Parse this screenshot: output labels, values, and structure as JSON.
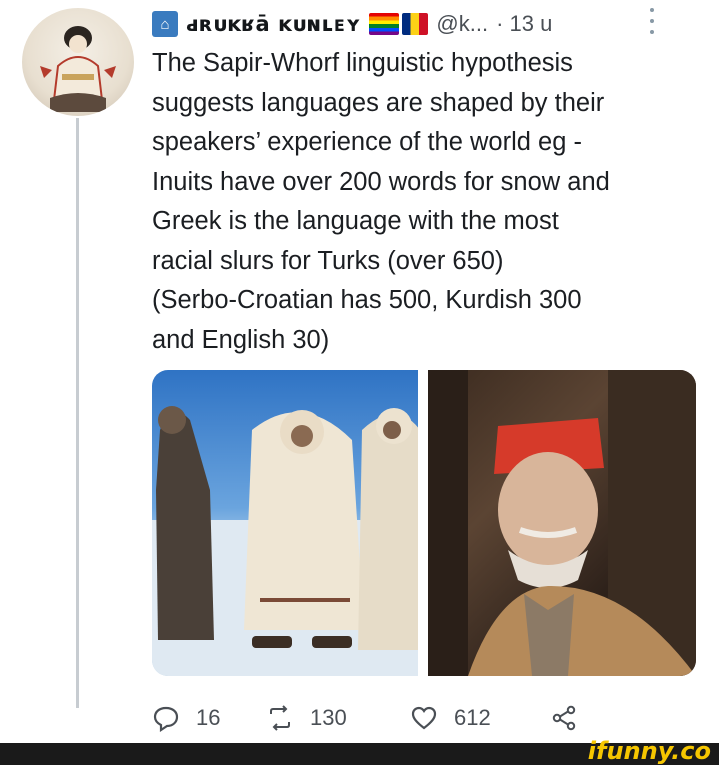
{
  "tweet": {
    "display_name": "ԁʀᴜᴋʁā ᴋᴜɴʟᴇʏ",
    "handle": "@k...",
    "time": "· 13 u",
    "text": "The Sapir-Whorf linguistic hypothesis\nsuggests languages are shaped by their\nspeakers’ experience of the world eg -\nInuits have over 200 words for snow and\nGreek is the language with the most\nracial slurs for Turks (over 650)\n(Serbo-Croatian has 500, Kurdish 300\nand English 30)",
    "icons": {
      "name_badge": "building-icon",
      "flag_1": "rainbow-flag-icon",
      "flag_2": "romania-flag-icon",
      "more": "more-vertical-icon"
    },
    "media": [
      {
        "name": "photo-people-in-fur-coats-on-snow"
      },
      {
        "name": "photo-old-man-in-red-fez"
      }
    ]
  },
  "actions": {
    "reply_count": "16",
    "retweet_count": "130",
    "like_count": "612"
  },
  "watermark": "ifunny.co",
  "colors": {
    "text": "#14171a",
    "secondary": "#4a4f55",
    "thread_line": "#c7ccd1",
    "watermark": "#f6c600"
  }
}
